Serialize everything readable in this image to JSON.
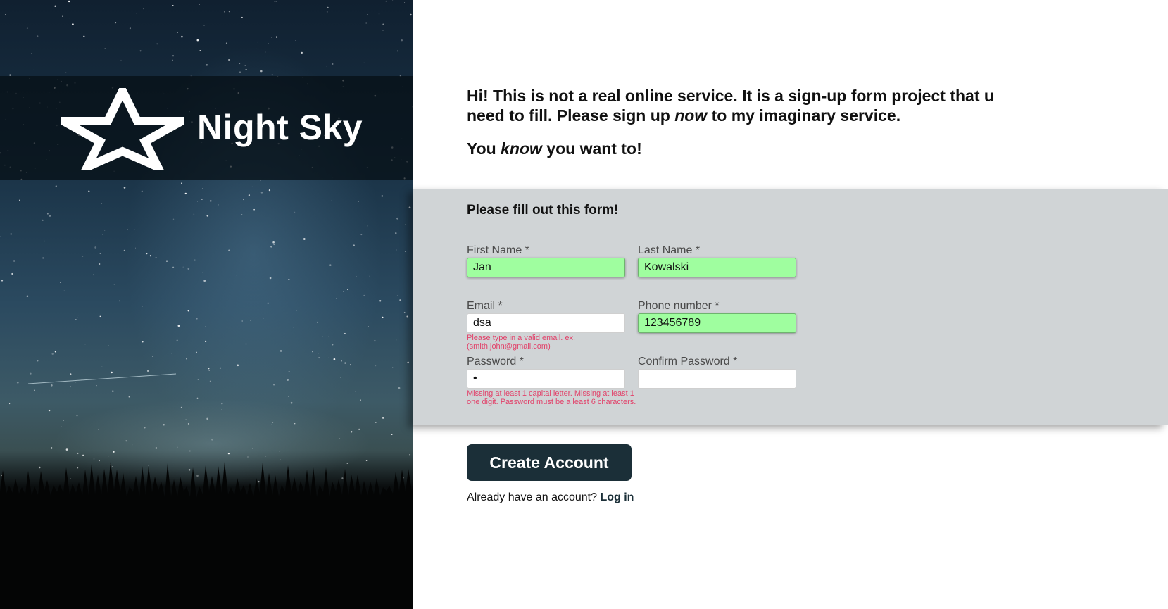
{
  "brand": {
    "name": "Night Sky",
    "logo_icon": "star-outline-icon"
  },
  "intro": {
    "line1_before": "Hi! This is not a real online service. It is a sign-up form project that u need to fill. Please sign up ",
    "line1_emphasis": "now",
    "line1_after": " to my imaginary service.",
    "line2_before": "You ",
    "line2_emphasis": "know",
    "line2_after": " you want to!"
  },
  "form": {
    "title": "Please fill out this form!",
    "valid_color": "#9ffe9f",
    "error_color": "#e2426a",
    "fields": {
      "first_name": {
        "label": "First Name *",
        "value": "Jan",
        "state": "valid"
      },
      "last_name": {
        "label": "Last Name *",
        "value": "Kowalski",
        "state": "valid"
      },
      "email": {
        "label": "Email *",
        "value": "dsa",
        "state": "invalid",
        "error": "Please type in a valid email. ex. (smith.john@gmail.com)"
      },
      "phone": {
        "label": "Phone number *",
        "value": "123456789",
        "state": "valid"
      },
      "password": {
        "label": "Password *",
        "value": "a",
        "state": "invalid",
        "error": "Missing at least 1 capital letter. Missing at least 1 one digit. Password must be a least 6 characters."
      },
      "confirm_password": {
        "label": "Confirm Password *",
        "value": "",
        "state": "empty"
      }
    }
  },
  "actions": {
    "create_label": "Create Account",
    "button_color": "#1b2f38",
    "login_prompt": "Already have an account? ",
    "login_link": "Log in"
  }
}
